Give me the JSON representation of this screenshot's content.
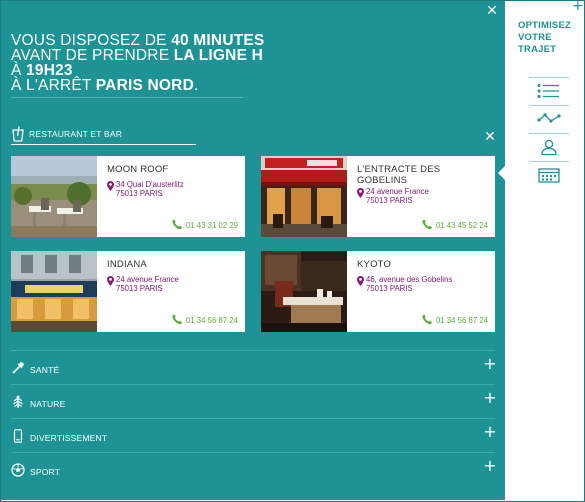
{
  "header": {
    "line1_prefix": "VOUS DISPOSEZ DE ",
    "line1_bold": "40 MINUTES",
    "line2_prefix": "AVANT DE PRENDRE ",
    "line2_bold": "LA LIGNE H",
    "line3_prefix": "À ",
    "line3_bold": "19H23",
    "line4_prefix": "À L'ARRÊT ",
    "line4_bold": "PARIS NORD",
    "line4_suffix": "."
  },
  "category": {
    "label": "RESTAURANT ET BAR",
    "icon": "cup-icon"
  },
  "places": [
    {
      "name": "MOON ROOF",
      "address1": "34 Quai D'austerlitz",
      "address2": "75013 PARIS",
      "phone": "01 43 31 02 29"
    },
    {
      "name": "L'ENTRACTE DES GOBELINS",
      "address1": "24 avenue France",
      "address2": "75013 PARIS",
      "phone": "01 43 45 52 24"
    },
    {
      "name": "INDIANA",
      "address1": "24 avenue France",
      "address2": "75013 PARIS",
      "phone": "01 34 56 87 24"
    },
    {
      "name": "KYOTO",
      "address1": "46, avenue des Gobelins",
      "address2": "75013 PARIS",
      "phone": "01 34 56 87 24"
    }
  ],
  "accordion": [
    {
      "label": "SANTÉ",
      "icon": "dropper-icon"
    },
    {
      "label": "NATURE",
      "icon": "tree-icon"
    },
    {
      "label": "DIVERTISSEMENT",
      "icon": "phone-device-icon"
    },
    {
      "label": "SPORT",
      "icon": "ball-icon"
    }
  ],
  "sidebar": {
    "title": "OPTIMISEZ VOTRE TRAJET",
    "nav": [
      "list-icon",
      "route-icon",
      "user-icon",
      "calendar-icon"
    ]
  },
  "colors": {
    "teal": "#1e9396",
    "purple": "#8a1c78",
    "green": "#5bb033"
  }
}
